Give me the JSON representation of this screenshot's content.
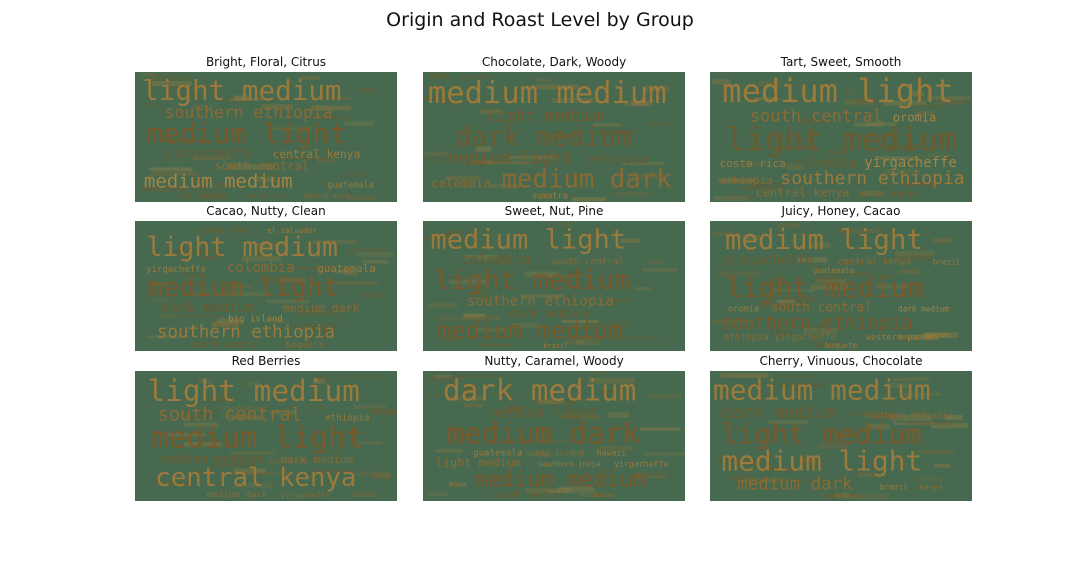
{
  "figure": {
    "title": "Origin and Roast Level by Group",
    "background": "#46694f",
    "word_colors": [
      "#9c7a3c",
      "#8a6a35",
      "#7a5a2c",
      "#6b5a30",
      "#a58445"
    ]
  },
  "chart_data": [
    {
      "type": "wordcloud",
      "title": "Bright, Floral, Citrus",
      "words": [
        {
          "text": "light medium",
          "size": 32,
          "color": "#9c7a3c"
        },
        {
          "text": "southern ethiopia",
          "size": 19,
          "color": "#8a6a35"
        },
        {
          "text": "medium light",
          "size": 32,
          "color": "#7a5a2c"
        },
        {
          "text": "yirgacheffe",
          "size": 15,
          "color": "#6b5a30"
        },
        {
          "text": "central kenya",
          "size": 13,
          "color": "#9c7a3c"
        },
        {
          "text": "south central",
          "size": 14,
          "color": "#8a6a35"
        },
        {
          "text": "medium medium",
          "size": 22,
          "color": "#a58445"
        },
        {
          "text": "guatemala",
          "size": 10,
          "color": "#9c7a3c"
        },
        {
          "text": "colombia",
          "size": 11,
          "color": "#7a5a2c"
        },
        {
          "text": "costa rica",
          "size": 9,
          "color": "#6b5a30"
        },
        {
          "text": "medium dark",
          "size": 8,
          "color": "#8a6a35"
        }
      ]
    },
    {
      "type": "wordcloud",
      "title": "Chocolate, Dark, Woody",
      "words": [
        {
          "text": "medium medium",
          "size": 32,
          "color": "#9c7a3c"
        },
        {
          "text": "light medium",
          "size": 17,
          "color": "#7a5a2c"
        },
        {
          "text": "dark medium",
          "size": 28,
          "color": "#6b5a30"
        },
        {
          "text": "medium light",
          "size": 18,
          "color": "#7a5a2c"
        },
        {
          "text": "ethiopia",
          "size": 13,
          "color": "#6b5a30"
        },
        {
          "text": "colombia",
          "size": 13,
          "color": "#8a6a35"
        },
        {
          "text": "medium dark",
          "size": 27,
          "color": "#8a6a35"
        },
        {
          "text": "sumatra",
          "size": 9,
          "color": "#9c7a3c"
        }
      ]
    },
    {
      "type": "wordcloud",
      "title": "Tart, Sweet, Smooth",
      "words": [
        {
          "text": "medium light",
          "size": 32,
          "color": "#9c7a3c"
        },
        {
          "text": "south central",
          "size": 17,
          "color": "#8a6a35"
        },
        {
          "text": "oromia",
          "size": 12,
          "color": "#a58445"
        },
        {
          "text": "light medium",
          "size": 32,
          "color": "#6b5a30"
        },
        {
          "text": "costa rica",
          "size": 11,
          "color": "#9c7a3c"
        },
        {
          "text": "colombia",
          "size": 13,
          "color": "#6b5a30"
        },
        {
          "text": "yirgacheffe",
          "size": 14,
          "color": "#a58445"
        },
        {
          "text": "ethiopia",
          "size": 11,
          "color": "#8a6a35"
        },
        {
          "text": "southern ethiopia",
          "size": 18,
          "color": "#9c7a3c"
        },
        {
          "text": "central kenya",
          "size": 12,
          "color": "#8a6a35"
        },
        {
          "text": "el salvador",
          "size": 9,
          "color": "#7a5a2c"
        }
      ]
    },
    {
      "type": "wordcloud",
      "title": "Cacao, Nutty, Clean",
      "words": [
        {
          "text": "costa rica",
          "size": 10,
          "color": "#7a5a2c"
        },
        {
          "text": "el salvador",
          "size": 9,
          "color": "#9c7a3c"
        },
        {
          "text": "light medium",
          "size": 32,
          "color": "#9c7a3c"
        },
        {
          "text": "yirgacheffe",
          "size": 11,
          "color": "#9c7a3c"
        },
        {
          "text": "colombia",
          "size": 17,
          "color": "#8a6a35"
        },
        {
          "text": "guatemala",
          "size": 13,
          "color": "#9c7a3c"
        },
        {
          "text": "medium light",
          "size": 32,
          "color": "#7a5a2c"
        },
        {
          "text": "dark medium",
          "size": 17,
          "color": "#6b5a30"
        },
        {
          "text": "medium dark",
          "size": 14,
          "color": "#8a6a35"
        },
        {
          "text": "big island",
          "size": 11,
          "color": "#a58445"
        },
        {
          "text": "southern ethiopia",
          "size": 21,
          "color": "#9c7a3c"
        },
        {
          "text": "south central",
          "size": 11,
          "color": "#7a5a2c"
        },
        {
          "text": "boquete",
          "size": 11,
          "color": "#8a6a35"
        }
      ]
    },
    {
      "type": "wordcloud",
      "title": "Sweet, Nut, Pine",
      "words": [
        {
          "text": "medium light",
          "size": 32,
          "color": "#9c7a3c"
        },
        {
          "text": "colombia",
          "size": 17,
          "color": "#6b5a30"
        },
        {
          "text": "south central",
          "size": 11,
          "color": "#8a6a35"
        },
        {
          "text": "light medium",
          "size": 32,
          "color": "#7a5a2c"
        },
        {
          "text": "southern ethiopia",
          "size": 17,
          "color": "#8a6a35"
        },
        {
          "text": "dark medium",
          "size": 14,
          "color": "#6b5a30"
        },
        {
          "text": "medium medium",
          "size": 28,
          "color": "#7a5a2c"
        },
        {
          "text": "brazil",
          "size": 8,
          "color": "#9c7a3c"
        }
      ]
    },
    {
      "type": "wordcloud",
      "title": "Juicy, Honey, Cacao",
      "words": [
        {
          "text": "medium light",
          "size": 32,
          "color": "#9c7a3c"
        },
        {
          "text": "yirgacheffe",
          "size": 16,
          "color": "#6b5a30"
        },
        {
          "text": "central kenya",
          "size": 11,
          "color": "#8a6a35"
        },
        {
          "text": "brazil",
          "size": 9,
          "color": "#9c7a3c"
        },
        {
          "text": "guatemala",
          "size": 9,
          "color": "#9c7a3c"
        },
        {
          "text": "light medium",
          "size": 32,
          "color": "#7a5a2c"
        },
        {
          "text": "oromia",
          "size": 10,
          "color": "#9c7a3c"
        },
        {
          "text": "south central",
          "size": 15,
          "color": "#8a6a35"
        },
        {
          "text": "dark medium",
          "size": 9,
          "color": "#a58445"
        },
        {
          "text": "southern ethiopia",
          "size": 22,
          "color": "#7a5a2c"
        },
        {
          "text": "ethiopia yirgacheffe",
          "size": 11,
          "color": "#8a6a35"
        },
        {
          "text": "western panama",
          "size": 10,
          "color": "#9c7a3c"
        },
        {
          "text": "boquete",
          "size": 9,
          "color": "#9c7a3c"
        }
      ]
    },
    {
      "type": "wordcloud",
      "title": "Red Berries",
      "words": [
        {
          "text": "light medium",
          "size": 32,
          "color": "#9c7a3c"
        },
        {
          "text": "south central",
          "size": 20,
          "color": "#8a6a35"
        },
        {
          "text": "ethiopia",
          "size": 10,
          "color": "#9c7a3c"
        },
        {
          "text": "medium light",
          "size": 32,
          "color": "#7a5a2c"
        },
        {
          "text": "medium medium",
          "size": 14,
          "color": "#6b5a30"
        },
        {
          "text": "dark medium",
          "size": 12,
          "color": "#8a6a35"
        },
        {
          "text": "central kenya",
          "size": 28,
          "color": "#9c7a3c"
        },
        {
          "text": "medium dark",
          "size": 10,
          "color": "#8a6a35"
        },
        {
          "text": "yirgacheffe",
          "size": 8,
          "color": "#8a6a35"
        }
      ]
    },
    {
      "type": "wordcloud",
      "title": "Nutty, Caramel, Woody",
      "words": [
        {
          "text": "dark medium",
          "size": 32,
          "color": "#9c7a3c"
        },
        {
          "text": "medium light",
          "size": 16,
          "color": "#6b5a30"
        },
        {
          "text": "medium dark",
          "size": 32,
          "color": "#7a5a2c"
        },
        {
          "text": "guatemala",
          "size": 10,
          "color": "#9c7a3c"
        },
        {
          "text": "big island",
          "size": 9,
          "color": "#8a6a35"
        },
        {
          "text": "hawaii",
          "size": 9,
          "color": "#9c7a3c"
        },
        {
          "text": "light medium",
          "size": 13,
          "color": "#8a6a35"
        },
        {
          "text": "southern india",
          "size": 8,
          "color": "#9c7a3c"
        },
        {
          "text": "yirgacheffe",
          "size": 9,
          "color": "#9c7a3c"
        },
        {
          "text": "kona",
          "size": 8,
          "color": "#9c7a3c"
        },
        {
          "text": "medium medium",
          "size": 24,
          "color": "#7a5a2c"
        },
        {
          "text": "south central",
          "size": 10,
          "color": "#7a5a2c"
        },
        {
          "text": "honduras",
          "size": 8,
          "color": "#8a6a35"
        }
      ]
    },
    {
      "type": "wordcloud",
      "title": "Cherry, Vinuous, Chocolate",
      "words": [
        {
          "text": "medium medium",
          "size": 32,
          "color": "#9c7a3c"
        },
        {
          "text": "dark medium",
          "size": 20,
          "color": "#6b5a30"
        },
        {
          "text": "southern ethiopia",
          "size": 10,
          "color": "#8a6a35"
        },
        {
          "text": "light medium",
          "size": 32,
          "color": "#7a5a2c"
        },
        {
          "text": "medium light",
          "size": 32,
          "color": "#9c7a3c"
        },
        {
          "text": "medium dark",
          "size": 20,
          "color": "#8a6a35"
        },
        {
          "text": "brazil",
          "size": 9,
          "color": "#9c7a3c"
        },
        {
          "text": "kenya",
          "size": 9,
          "color": "#8a6a35"
        },
        {
          "text": "papua new",
          "size": 8,
          "color": "#7a5a2c"
        }
      ]
    }
  ]
}
